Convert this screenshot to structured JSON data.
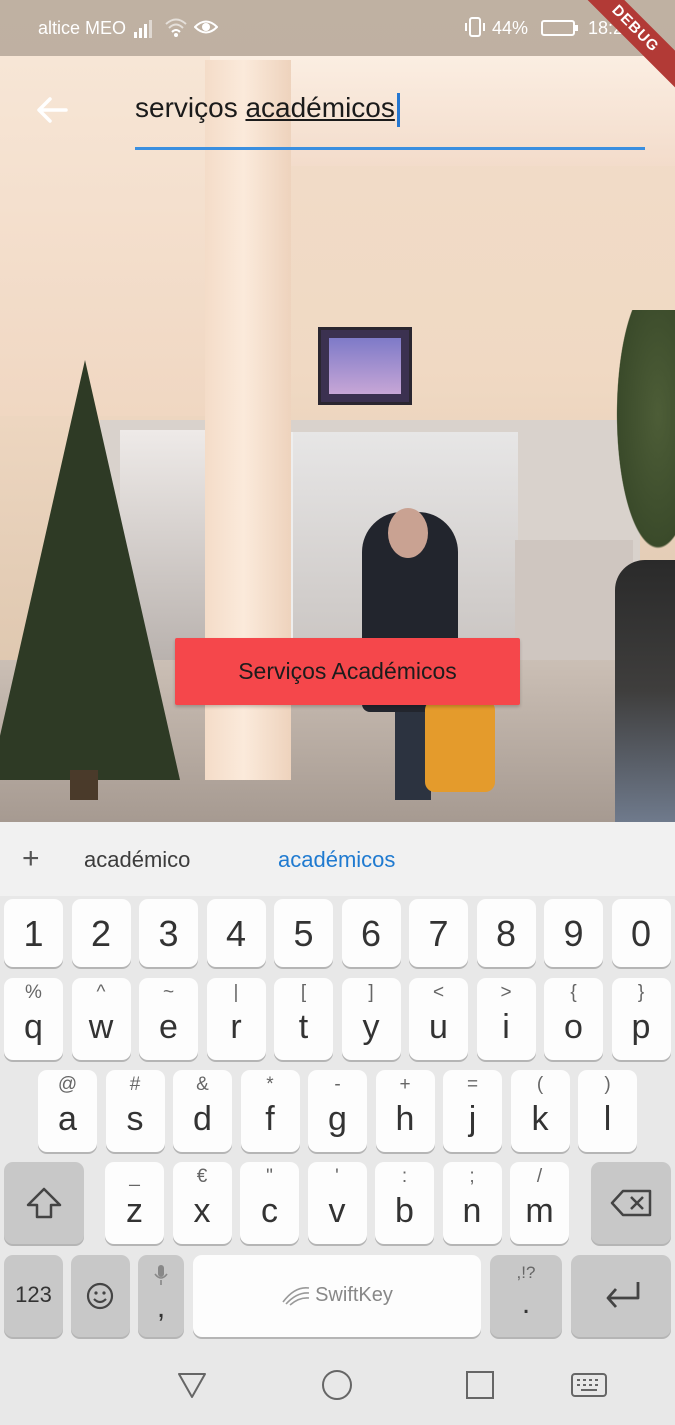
{
  "status_bar": {
    "carrier": "altice MEO",
    "battery_percent": "44%",
    "time": "18:22",
    "debug_label": "DEBUG"
  },
  "search": {
    "value_plain": "serviços ",
    "value_underlined": "académicos"
  },
  "result": {
    "label": "Serviços Académicos"
  },
  "keyboard": {
    "suggestions": [
      "académico",
      "académicos"
    ],
    "number_row": [
      "1",
      "2",
      "3",
      "4",
      "5",
      "6",
      "7",
      "8",
      "9",
      "0"
    ],
    "row1": [
      {
        "main": "q",
        "sub": "%"
      },
      {
        "main": "w",
        "sub": "^"
      },
      {
        "main": "e",
        "sub": "~"
      },
      {
        "main": "r",
        "sub": "|"
      },
      {
        "main": "t",
        "sub": "["
      },
      {
        "main": "y",
        "sub": "]"
      },
      {
        "main": "u",
        "sub": "<"
      },
      {
        "main": "i",
        "sub": ">"
      },
      {
        "main": "o",
        "sub": "{"
      },
      {
        "main": "p",
        "sub": "}"
      }
    ],
    "row2": [
      {
        "main": "a",
        "sub": "@"
      },
      {
        "main": "s",
        "sub": "#"
      },
      {
        "main": "d",
        "sub": "&"
      },
      {
        "main": "f",
        "sub": "*"
      },
      {
        "main": "g",
        "sub": "-"
      },
      {
        "main": "h",
        "sub": "+"
      },
      {
        "main": "j",
        "sub": "="
      },
      {
        "main": "k",
        "sub": "("
      },
      {
        "main": "l",
        "sub": ")"
      }
    ],
    "row3": [
      {
        "main": "z",
        "sub": "_"
      },
      {
        "main": "x",
        "sub": "€"
      },
      {
        "main": "c",
        "sub": "\""
      },
      {
        "main": "v",
        "sub": "'"
      },
      {
        "main": "b",
        "sub": ":"
      },
      {
        "main": "n",
        "sub": ";"
      },
      {
        "main": "m",
        "sub": "/"
      }
    ],
    "symbols_label": "123",
    "comma": ",",
    "space_label": "SwiftKey",
    "period": ".",
    "period_sub": ",!?"
  }
}
